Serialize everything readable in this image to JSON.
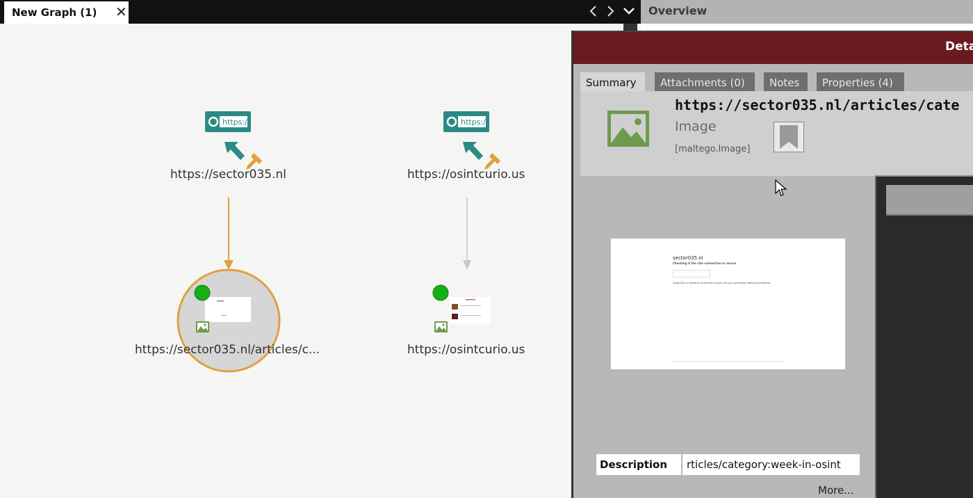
{
  "tabs": {
    "graph_tab_title": "New Graph (1)",
    "close_glyph": "✕"
  },
  "overview": {
    "title": "Overview"
  },
  "graph": {
    "nodes": [
      {
        "label": "https://sector035.nl",
        "badge": "https://",
        "icon": "website-icon"
      },
      {
        "label": "https://osintcurio.us",
        "badge": "https://",
        "icon": "website-icon"
      },
      {
        "label": "https://sector035.nl/articles/c...",
        "icon": "image-icon",
        "selected": true
      },
      {
        "label": "https://osintcurio.us",
        "icon": "image-icon"
      }
    ],
    "colors": {
      "selected_edge": "#e0a040",
      "edge": "#c8c8c8",
      "teal": "#2c8a84",
      "status_dot": "#16b016"
    }
  },
  "detail": {
    "title": "Deta",
    "tabs": [
      "Summary",
      "Attachments (0)",
      "Notes",
      "Properties (4)"
    ],
    "active_tab": "Summary",
    "entity_url": "https://sector035.nl/articles/cate",
    "entity_type": "Image",
    "entity_class": "[maltego.Image]",
    "description_label": "Description",
    "description_value": "rticles/category:week-in-osint",
    "more_link": "More...",
    "preview": {
      "site": "sector035.nl",
      "heading": "Checking if the site connection is secure",
      "body": "sector035.nl needs to review the security of your connection before proceeding."
    },
    "colors": {
      "header": "#6b1a20",
      "image_icon": "#6f9a4e"
    }
  }
}
